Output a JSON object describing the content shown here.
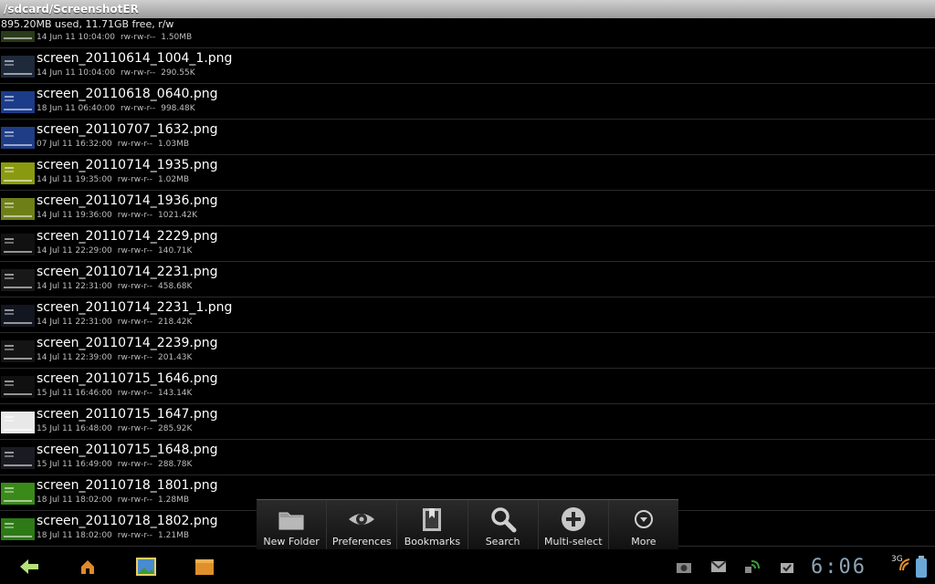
{
  "header": {
    "path": "/sdcard/ScreenshotER",
    "storage": "895.20MB used, 11.71GB free, r/w"
  },
  "colors": {
    "toolbar_bg": "#1c1c1c",
    "title_bar": "#b5b5b5",
    "clock": "#8fa3b3"
  },
  "files": [
    {
      "name": "",
      "date": "14 Jun 11 10:04:00",
      "perm": "rw-rw-r--",
      "size": "1.50MB",
      "thumb": "#2a3a1a"
    },
    {
      "name": "screen_20110614_1004_1.png",
      "date": "14 Jun 11 10:04:00",
      "perm": "rw-rw-r--",
      "size": "290.55K",
      "thumb": "#1e2a3a"
    },
    {
      "name": "screen_20110618_0640.png",
      "date": "18 Jun 11 06:40:00",
      "perm": "rw-rw-r--",
      "size": "998.48K",
      "thumb": "#1c3c8a"
    },
    {
      "name": "screen_20110707_1632.png",
      "date": "07 Jul 11 16:32:00",
      "perm": "rw-rw-r--",
      "size": "1.03MB",
      "thumb": "#1f3d86"
    },
    {
      "name": "screen_20110714_1935.png",
      "date": "14 Jul 11 19:35:00",
      "perm": "rw-rw-r--",
      "size": "1.02MB",
      "thumb": "#8a9a10"
    },
    {
      "name": "screen_20110714_1936.png",
      "date": "14 Jul 11 19:36:00",
      "perm": "rw-rw-r--",
      "size": "1021.42K",
      "thumb": "#6f7f18"
    },
    {
      "name": "screen_20110714_2229.png",
      "date": "14 Jul 11 22:29:00",
      "perm": "rw-rw-r--",
      "size": "140.71K",
      "thumb": "#111111"
    },
    {
      "name": "screen_20110714_2231.png",
      "date": "14 Jul 11 22:31:00",
      "perm": "rw-rw-r--",
      "size": "458.68K",
      "thumb": "#181818"
    },
    {
      "name": "screen_20110714_2231_1.png",
      "date": "14 Jul 11 22:31:00",
      "perm": "rw-rw-r--",
      "size": "218.42K",
      "thumb": "#121620"
    },
    {
      "name": "screen_20110714_2239.png",
      "date": "14 Jul 11 22:39:00",
      "perm": "rw-rw-r--",
      "size": "201.43K",
      "thumb": "#141414"
    },
    {
      "name": "screen_20110715_1646.png",
      "date": "15 Jul 11 16:46:00",
      "perm": "rw-rw-r--",
      "size": "143.14K",
      "thumb": "#101010"
    },
    {
      "name": "screen_20110715_1647.png",
      "date": "15 Jul 11 16:48:00",
      "perm": "rw-rw-r--",
      "size": "285.92K",
      "thumb": "#e8e8e8"
    },
    {
      "name": "screen_20110715_1648.png",
      "date": "15 Jul 11 16:49:00",
      "perm": "rw-rw-r--",
      "size": "288.78K",
      "thumb": "#1a1a22"
    },
    {
      "name": "screen_20110718_1801.png",
      "date": "18 Jul 11 18:02:00",
      "perm": "rw-rw-r--",
      "size": "1.28MB",
      "thumb": "#3a8a1a"
    },
    {
      "name": "screen_20110718_1802.png",
      "date": "18 Jul 11 18:02:00",
      "perm": "rw-rw-r--",
      "size": "1.21MB",
      "thumb": "#2e7a16"
    }
  ],
  "toolbar": {
    "new_folder": "New Folder",
    "preferences": "Preferences",
    "bookmarks": "Bookmarks",
    "search": "Search",
    "multi_select": "Multi-select",
    "more": "More"
  },
  "system": {
    "time": "6:06",
    "signal": "3G"
  }
}
